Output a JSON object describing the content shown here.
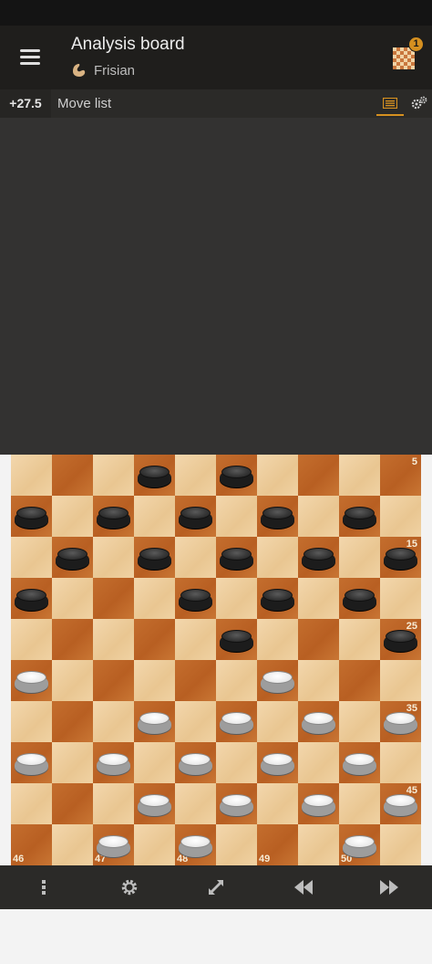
{
  "header": {
    "title": "Analysis board",
    "variant": "Frisian",
    "notification_count": "1"
  },
  "toolbar": {
    "evaluation": "+27.5",
    "move_list_label": "Move list"
  },
  "board": {
    "black_pieces": [
      2,
      3,
      6,
      7,
      8,
      9,
      10,
      11,
      12,
      13,
      14,
      15,
      16,
      18,
      19,
      20,
      23,
      25
    ],
    "white_pieces": [
      26,
      29,
      32,
      33,
      34,
      35,
      36,
      37,
      38,
      39,
      40,
      42,
      43,
      44,
      45,
      47,
      48,
      50
    ],
    "square_labels": [
      "5",
      "15",
      "25",
      "35",
      "45",
      "46",
      "47",
      "48",
      "49",
      "50"
    ]
  },
  "icons": {
    "menu": "hamburger-menu-icon",
    "variant": "frisian-variant-icon",
    "board": "board-thumbnail-icon",
    "move_list_tab": "list-icon",
    "settings_tab": "gears-icon",
    "more": "vertical-dots-icon",
    "settings": "gear-icon",
    "flip": "expand-arrows-icon",
    "back": "rewind-icon",
    "forward": "fast-forward-icon"
  },
  "colors": {
    "accent": "#d59020",
    "light_square": "#f0d2a3",
    "dark_square": "#c06a2a"
  }
}
